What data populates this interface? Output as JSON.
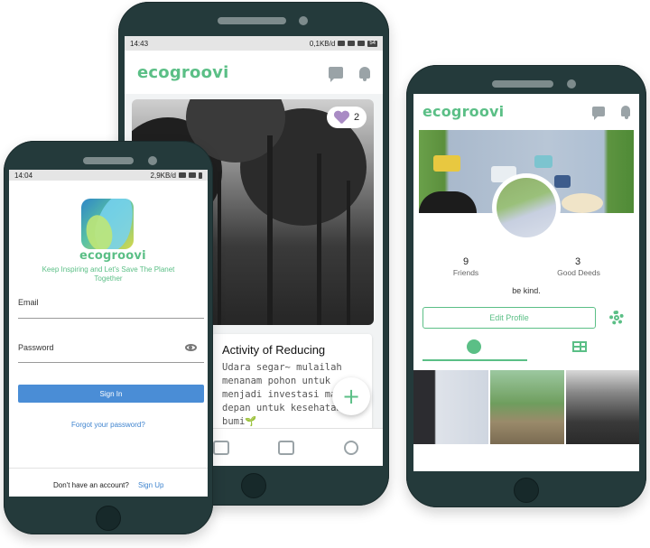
{
  "brand": {
    "name": "ecogroovi",
    "accent": "#5bbf86",
    "link_color": "#3f84cf"
  },
  "login_screen": {
    "status": {
      "time": "14:04",
      "network": "2,9KB/d",
      "battery": ""
    },
    "app_icon": "ecogroovi-leaf-icon",
    "logo": "ecogroovi",
    "tagline": "Keep Inspiring and Let's Save The Planet Together",
    "email_label": "Email",
    "password_label": "Password",
    "sign_in_label": "Sign In",
    "forgot_label": "Forgot your password?",
    "no_account_label": "Don't have an account?",
    "sign_up_label": "Sign Up"
  },
  "feed_screen": {
    "status": {
      "time": "14:43",
      "network": "0,1KB/d",
      "battery": "54"
    },
    "logo": "ecogroovi",
    "post": {
      "like_count": "2",
      "title": "Activity of Reducing",
      "body": "Udara segar~ mulailah\nmenanam pohon untuk\nmenjadi investasi masa\ndepan untuk kesehatan\nbumi🌱",
      "fab_label": "+"
    },
    "nav_icons": [
      "search-icon",
      "gift-icon",
      "calendar-icon",
      "profile-icon"
    ]
  },
  "profile_screen": {
    "logo": "ecogroovi",
    "stats": [
      {
        "value": "9",
        "label": "Friends"
      },
      {
        "value": "3",
        "label": "Good Deeds"
      }
    ],
    "bio": "be kind.",
    "edit_label": "Edit Profile",
    "tabs": [
      "globe-icon",
      "grid-icon"
    ]
  }
}
